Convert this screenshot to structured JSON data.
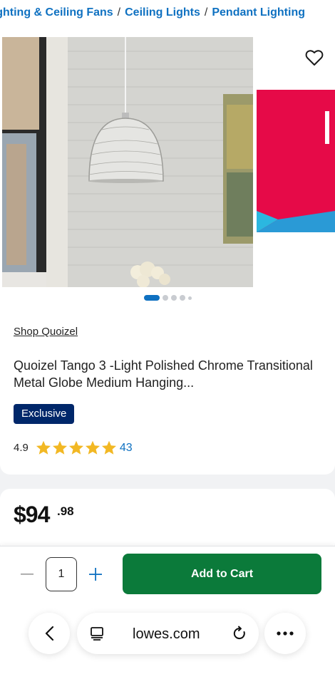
{
  "breadcrumb": {
    "items": [
      "Lighting & Ceiling Fans",
      "Ceiling Lights",
      "Pendant Lighting"
    ],
    "separator": "/"
  },
  "gallery": {
    "image_count": 5,
    "active_index": 0,
    "favorite_icon": "heart-outline-icon"
  },
  "product": {
    "brand_link": "Shop Quoizel",
    "title": "Quoizel Tango 3 -Light Polished Chrome Transitional Metal Globe Medium Hanging...",
    "badge": "Exclusive",
    "rating": "4.9",
    "rating_stars": 5,
    "review_count": "43"
  },
  "price": {
    "dollars": "$94",
    "cents": ".98"
  },
  "cart": {
    "quantity": "1",
    "add_to_cart_label": "Add to Cart"
  },
  "browser": {
    "url": "lowes.com"
  },
  "colors": {
    "link_blue": "#0f71c1",
    "badge_navy": "#00276a",
    "star_gold": "#f2b824",
    "cart_green": "#0b7a3a"
  }
}
